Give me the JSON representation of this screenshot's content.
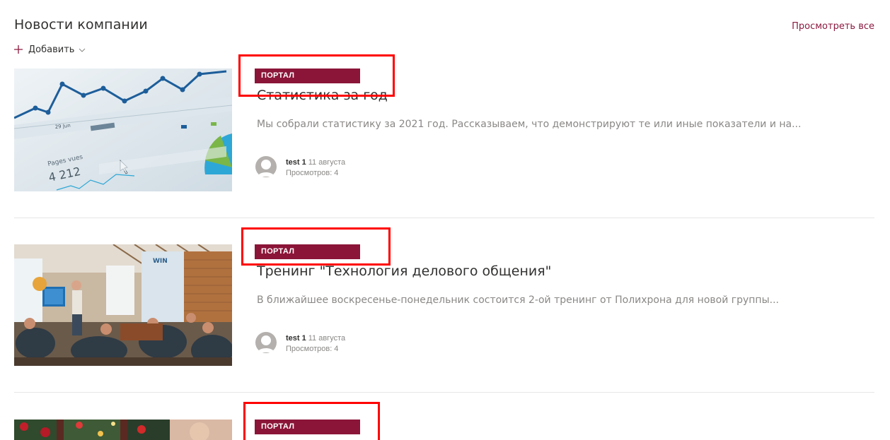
{
  "header": {
    "title": "Новости компании",
    "view_all_label": "Просмотреть все",
    "add_label": "Добавить"
  },
  "icons": {
    "add": "plus-icon",
    "add_dropdown": "chevron-down-icon",
    "avatar": "user-avatar-icon"
  },
  "colors": {
    "accent": "#8b1538",
    "link": "#8b1a3f",
    "highlight": "#ff0000"
  },
  "news": [
    {
      "category": "ПОРТАЛ",
      "title": "Статистика за год",
      "excerpt": "Мы собрали статистику за 2021 год. Рассказываем, что демонстрируют те или иные показатели и на...",
      "author": "test 1",
      "date": "11 августа",
      "views": "Просмотров: 4",
      "image": {
        "axis_label": "29 Jun",
        "metric_label": "Pages vues",
        "metric_value": "4 212"
      }
    },
    {
      "category": "ПОРТАЛ",
      "title": "Тренинг \"Технология делового общения\"",
      "excerpt": "В ближайшее воскресенье-понедельник состоится 2-ой тренинг от Полихрона для новой группы...",
      "author": "test 1",
      "date": "11 августа",
      "views": "Просмотров: 4",
      "image": {
        "wall_sign": "WIN"
      }
    },
    {
      "category": "ПОРТАЛ"
    }
  ]
}
